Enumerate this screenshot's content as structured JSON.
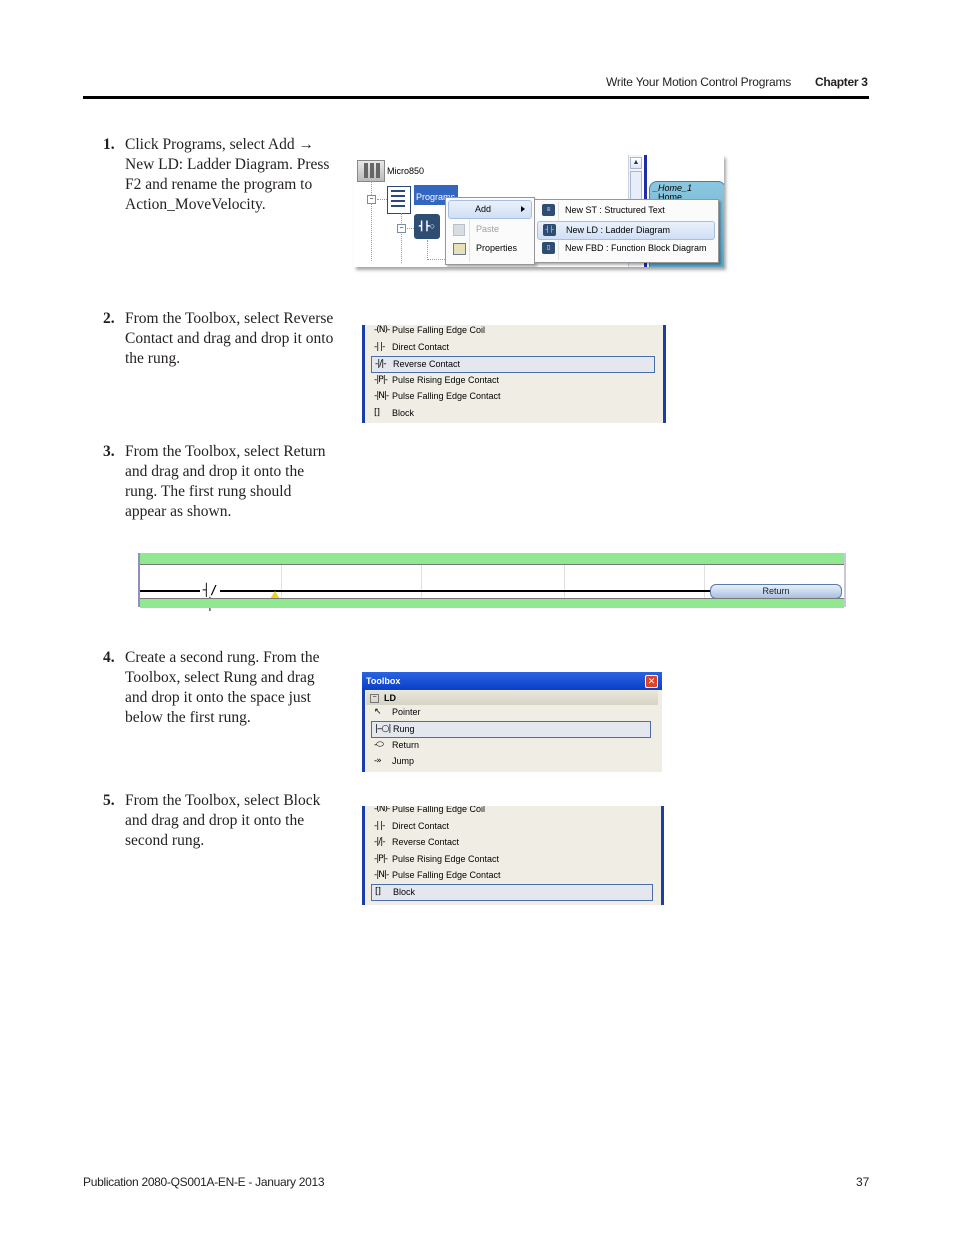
{
  "header": {
    "section_title": "Write Your Motion Control Programs",
    "chapter": "Chapter 3"
  },
  "steps": [
    {
      "number": "1.",
      "text": "Click Programs, select Add → New LD: Ladder Diagram. Press F2 and rename the program to Action_MoveVelocity."
    },
    {
      "number": "2.",
      "text": "From the Toolbox, select Reverse Contact and drag and drop it onto the rung."
    },
    {
      "number": "3.",
      "text": "From the Toolbox, select Return and drag and drop it onto the rung. The first rung should appear as shown."
    },
    {
      "number": "4.",
      "text": "Create a second rung. From the Toolbox, select Rung and drag and drop it onto the space just below the first rung."
    },
    {
      "number": "5.",
      "text": "From the Toolbox, select Block and drag and drop it onto the second rung."
    }
  ],
  "shot1": {
    "tree_root": "Micro850",
    "tree_programs": "Programs",
    "ld_icon_glyph": "┫┣○",
    "context_menu": [
      {
        "label": "Add",
        "icon": "none",
        "highlighted": true,
        "submenu": true
      },
      {
        "label": "Paste",
        "icon": "paste-icon",
        "disabled": true
      },
      {
        "label": "Properties",
        "icon": "properties-icon"
      }
    ],
    "submenu": [
      {
        "label": "New ST : Structured Text",
        "icon": "st-icon",
        "glyph": "≡"
      },
      {
        "label": "New LD : Ladder Diagram",
        "icon": "ld-icon",
        "glyph": "┤├",
        "highlighted": true
      },
      {
        "label": "New FBD : Function Block Diagram",
        "icon": "fbd-icon",
        "glyph": "▯"
      }
    ],
    "home_title": "_Home_1",
    "home_sub": "Home",
    "scroll_up_glyph": "▲"
  },
  "shot2": {
    "items": [
      {
        "label": "Pulse Falling Edge Coil",
        "glyph": "-(N)-"
      },
      {
        "label": "Direct Contact",
        "glyph": "-| |-"
      },
      {
        "label": "Reverse Contact",
        "glyph": "-|/|-",
        "selected": true
      },
      {
        "label": "Pulse Rising Edge Contact",
        "glyph": "-|P|-"
      },
      {
        "label": "Pulse Falling Edge Contact",
        "glyph": "-|N|-"
      },
      {
        "label": "Block",
        "glyph": "[]"
      }
    ]
  },
  "rung": {
    "contact_glyph": "┤/├",
    "return_label": "Return"
  },
  "shot4": {
    "title": "Toolbox",
    "close_glyph": "✕",
    "group": "LD",
    "group_glyph": "−",
    "items": [
      {
        "label": "Pointer",
        "glyph": "↖"
      },
      {
        "label": "Rung",
        "glyph": "|--○|",
        "selected": true
      },
      {
        "label": "Return",
        "glyph": "-⬭"
      },
      {
        "label": "Jump",
        "glyph": "-»"
      }
    ]
  },
  "shot5": {
    "items": [
      {
        "label": "Pulse Falling Edge Coil",
        "glyph": "-(N)-"
      },
      {
        "label": "Direct Contact",
        "glyph": "-| |-"
      },
      {
        "label": "Reverse Contact",
        "glyph": "-|/|-"
      },
      {
        "label": "Pulse Rising Edge Contact",
        "glyph": "-|P|-"
      },
      {
        "label": "Pulse Falling Edge Contact",
        "glyph": "-|N|-"
      },
      {
        "label": "Block",
        "glyph": "[]",
        "selected": true
      }
    ]
  },
  "footer": {
    "publication": "Publication 2080-QS001A-EN-E - January 2013",
    "page_number": "37"
  }
}
